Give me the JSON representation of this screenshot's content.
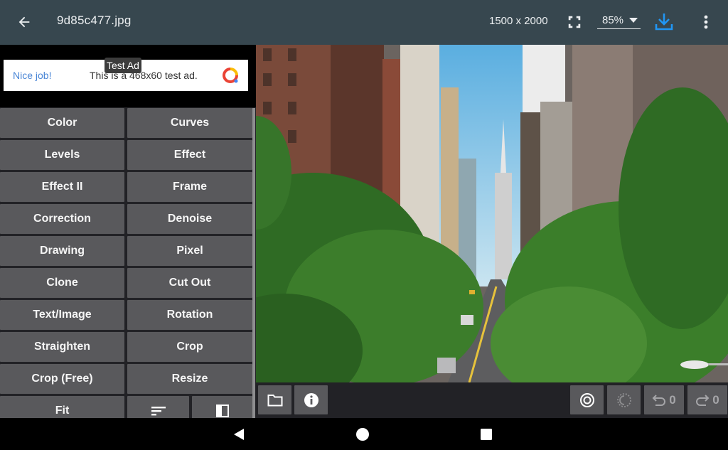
{
  "appbar": {
    "title": "9d85c477.jpg",
    "dimensions": "1500 x 2000",
    "zoom_level": "85%",
    "icons": {
      "back": "arrow-left-icon",
      "fullscreen": "fullscreen-icon",
      "zoom_dropdown": "caret-down-icon",
      "download": "download-icon",
      "more": "more-vert-icon"
    },
    "accent_color": "#2196f3",
    "background_color": "#37474f"
  },
  "ad": {
    "badge": "Test Ad",
    "headline": "Nice job!",
    "message": "This is a 468x60 test ad."
  },
  "tools": {
    "rows": [
      [
        "Color",
        "Curves"
      ],
      [
        "Levels",
        "Effect"
      ],
      [
        "Effect II",
        "Frame"
      ],
      [
        "Correction",
        "Denoise"
      ],
      [
        "Drawing",
        "Pixel"
      ],
      [
        "Clone",
        "Cut Out"
      ],
      [
        "Text/Image",
        "Rotation"
      ],
      [
        "Straighten",
        "Crop"
      ],
      [
        "Crop (Free)",
        "Resize"
      ]
    ],
    "last_row": {
      "fit": "Fit",
      "sort_icon": "sort-icon",
      "compare_icon": "compare-split-icon"
    }
  },
  "bottom_toolbar": {
    "open_icon": "folder-icon",
    "info_icon": "info-icon",
    "target_icon": "target-icon",
    "progress_icon": "dotted-circle-icon",
    "undo_count": "0",
    "redo_count": "0"
  },
  "image": {
    "description": "City street with tall buildings and green trees"
  },
  "navbar": {
    "back": "nav-back-icon",
    "home": "nav-home-icon",
    "recents": "nav-recents-icon"
  }
}
